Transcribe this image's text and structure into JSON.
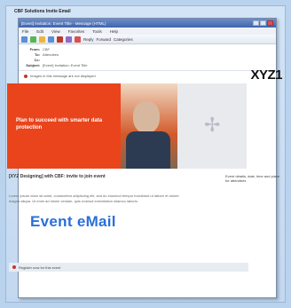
{
  "caption": "CBF Solutions Invite Email",
  "window": {
    "title": "[Event] Invitation: Event Title - Message (HTML)",
    "menu": [
      "File",
      "Edit",
      "View",
      "Favorites",
      "Tools",
      "Help"
    ],
    "toolbar_extra": [
      "Reply",
      "Forward",
      "Categories"
    ]
  },
  "headers": [
    {
      "key": "From:",
      "value": "CBF"
    },
    {
      "key": "To:",
      "value": "Attendees"
    },
    {
      "key": "Cc:",
      "value": ""
    },
    {
      "key": "Subject:",
      "value": "[Event] Invitation: Event Title"
    }
  ],
  "notice": "Images in this message are not displayed",
  "logo": "XYZ1",
  "banner": {
    "text": "Plan to succeed with smarter data protection"
  },
  "subject_line": "[XYZ Designing] with CBF: invite to join event",
  "sidebox": "Event details, date, time and place for attendees",
  "body_text": "Lorem ipsum dolor sit amet, consectetur adipiscing elit, sed do eiusmod tempor incididunt ut labore et dolore magna aliqua. Ut enim ad minim veniam, quis nostrud exercitation ullamco laboris.",
  "event_label": "Event  eMail",
  "footer": "Register now for this event"
}
